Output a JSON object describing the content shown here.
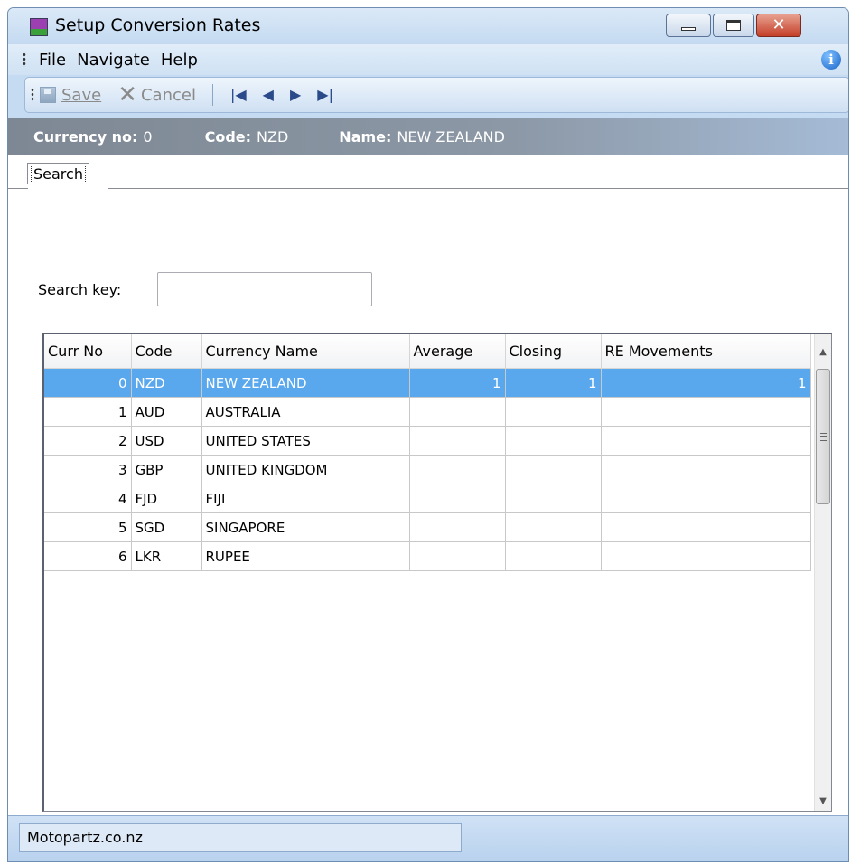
{
  "window": {
    "title": "Setup Conversion Rates"
  },
  "menu": {
    "items": [
      "File",
      "Navigate",
      "Help"
    ]
  },
  "toolbar": {
    "save_label": "Save",
    "cancel_label": "Cancel"
  },
  "header": {
    "currency_no_label": "Currency no:",
    "currency_no_value": "0",
    "code_label": "Code:",
    "code_value": "NZD",
    "name_label": "Name:",
    "name_value": "NEW ZEALAND"
  },
  "tabs": [
    {
      "label": "Search"
    }
  ],
  "search": {
    "label_prefix": "Search ",
    "label_underlined": "k",
    "label_suffix": "ey:",
    "value": ""
  },
  "grid": {
    "columns": [
      "Curr No",
      "Code",
      "Currency Name",
      "Average",
      "Closing",
      "RE Movements"
    ],
    "rows": [
      {
        "curr_no": "0",
        "code": "NZD",
        "name": "NEW ZEALAND",
        "average": "1",
        "closing": "1",
        "re_movements": "1",
        "selected": true
      },
      {
        "curr_no": "1",
        "code": "AUD",
        "name": "AUSTRALIA",
        "average": "",
        "closing": "",
        "re_movements": ""
      },
      {
        "curr_no": "2",
        "code": "USD",
        "name": "UNITED STATES",
        "average": "",
        "closing": "",
        "re_movements": ""
      },
      {
        "curr_no": "3",
        "code": "GBP",
        "name": "UNITED KINGDOM",
        "average": "",
        "closing": "",
        "re_movements": ""
      },
      {
        "curr_no": "4",
        "code": "FJD",
        "name": "FIJI",
        "average": "",
        "closing": "",
        "re_movements": ""
      },
      {
        "curr_no": "5",
        "code": "SGD",
        "name": "SINGAPORE",
        "average": "",
        "closing": "",
        "re_movements": ""
      },
      {
        "curr_no": "6",
        "code": "LKR",
        "name": "RUPEE",
        "average": "",
        "closing": "",
        "re_movements": ""
      }
    ]
  },
  "status": {
    "company": "Motopartz.co.nz"
  },
  "colors": {
    "selection": "#59a8ee",
    "header_strip": "#8c98a6",
    "window_frame": "#c4dbf1"
  }
}
